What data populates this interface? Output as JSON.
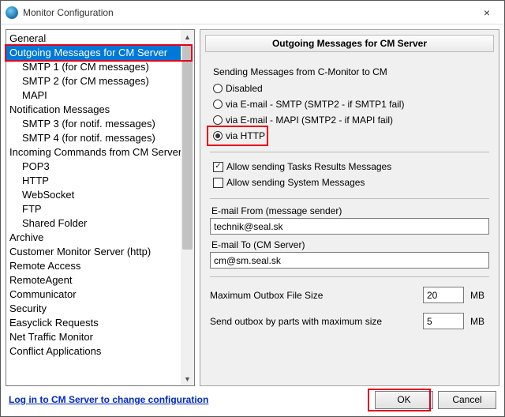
{
  "window": {
    "title": "Monitor Configuration",
    "close_icon": "×"
  },
  "nav": {
    "items": [
      {
        "label": "General",
        "child": false
      },
      {
        "label": "Outgoing Messages for CM Server",
        "child": false,
        "selected": true
      },
      {
        "label": "SMTP 1 (for CM messages)",
        "child": true
      },
      {
        "label": "SMTP 2 (for CM messages)",
        "child": true
      },
      {
        "label": "MAPI",
        "child": true
      },
      {
        "label": "Notification Messages",
        "child": false
      },
      {
        "label": "SMTP 3 (for notif. messages)",
        "child": true
      },
      {
        "label": "SMTP 4 (for notif. messages)",
        "child": true
      },
      {
        "label": "Incoming Commands from CM Server",
        "child": false
      },
      {
        "label": "POP3",
        "child": true
      },
      {
        "label": "HTTP",
        "child": true
      },
      {
        "label": "WebSocket",
        "child": true
      },
      {
        "label": "FTP",
        "child": true
      },
      {
        "label": "Shared Folder",
        "child": true
      },
      {
        "label": "Archive",
        "child": false
      },
      {
        "label": "Customer Monitor Server (http)",
        "child": false
      },
      {
        "label": "Remote Access",
        "child": false
      },
      {
        "label": "RemoteAgent",
        "child": false
      },
      {
        "label": "Communicator",
        "child": false
      },
      {
        "label": "Security",
        "child": false
      },
      {
        "label": "Easyclick Requests",
        "child": false
      },
      {
        "label": "Net Traffic Monitor",
        "child": false
      },
      {
        "label": "Conflict Applications",
        "child": false
      }
    ],
    "scroll": {
      "up": "▲",
      "down": "▼"
    }
  },
  "panel": {
    "title": "Outgoing Messages for CM Server",
    "sending_label": "Sending Messages from C-Monitor to CM",
    "radios": {
      "disabled": "Disabled",
      "smtp": "via E-mail - SMTP  (SMTP2 - if SMTP1 fail)",
      "mapi": "via E-mail - MAPI  (SMTP2 - if MAPI fail)",
      "http": "via HTTP"
    },
    "checks": {
      "tasks": "Allow sending Tasks Results Messages",
      "system": "Allow sending System Messages"
    },
    "email_from_label": "E-mail From (message sender)",
    "email_from_value": "technik@seal.sk",
    "email_to_label": "E-mail To (CM Server)",
    "email_to_value": "cm@sm.seal.sk",
    "max_outbox_label": "Maximum Outbox File Size",
    "max_outbox_value": "20",
    "send_parts_label": "Send outbox by parts with maximum size",
    "send_parts_value": "5",
    "unit": "MB"
  },
  "footer": {
    "link": "Log in to CM Server to change configuration",
    "ok": "OK",
    "cancel": "Cancel"
  },
  "colors": {
    "highlight": "#e2001a",
    "selection": "#0078d7"
  }
}
